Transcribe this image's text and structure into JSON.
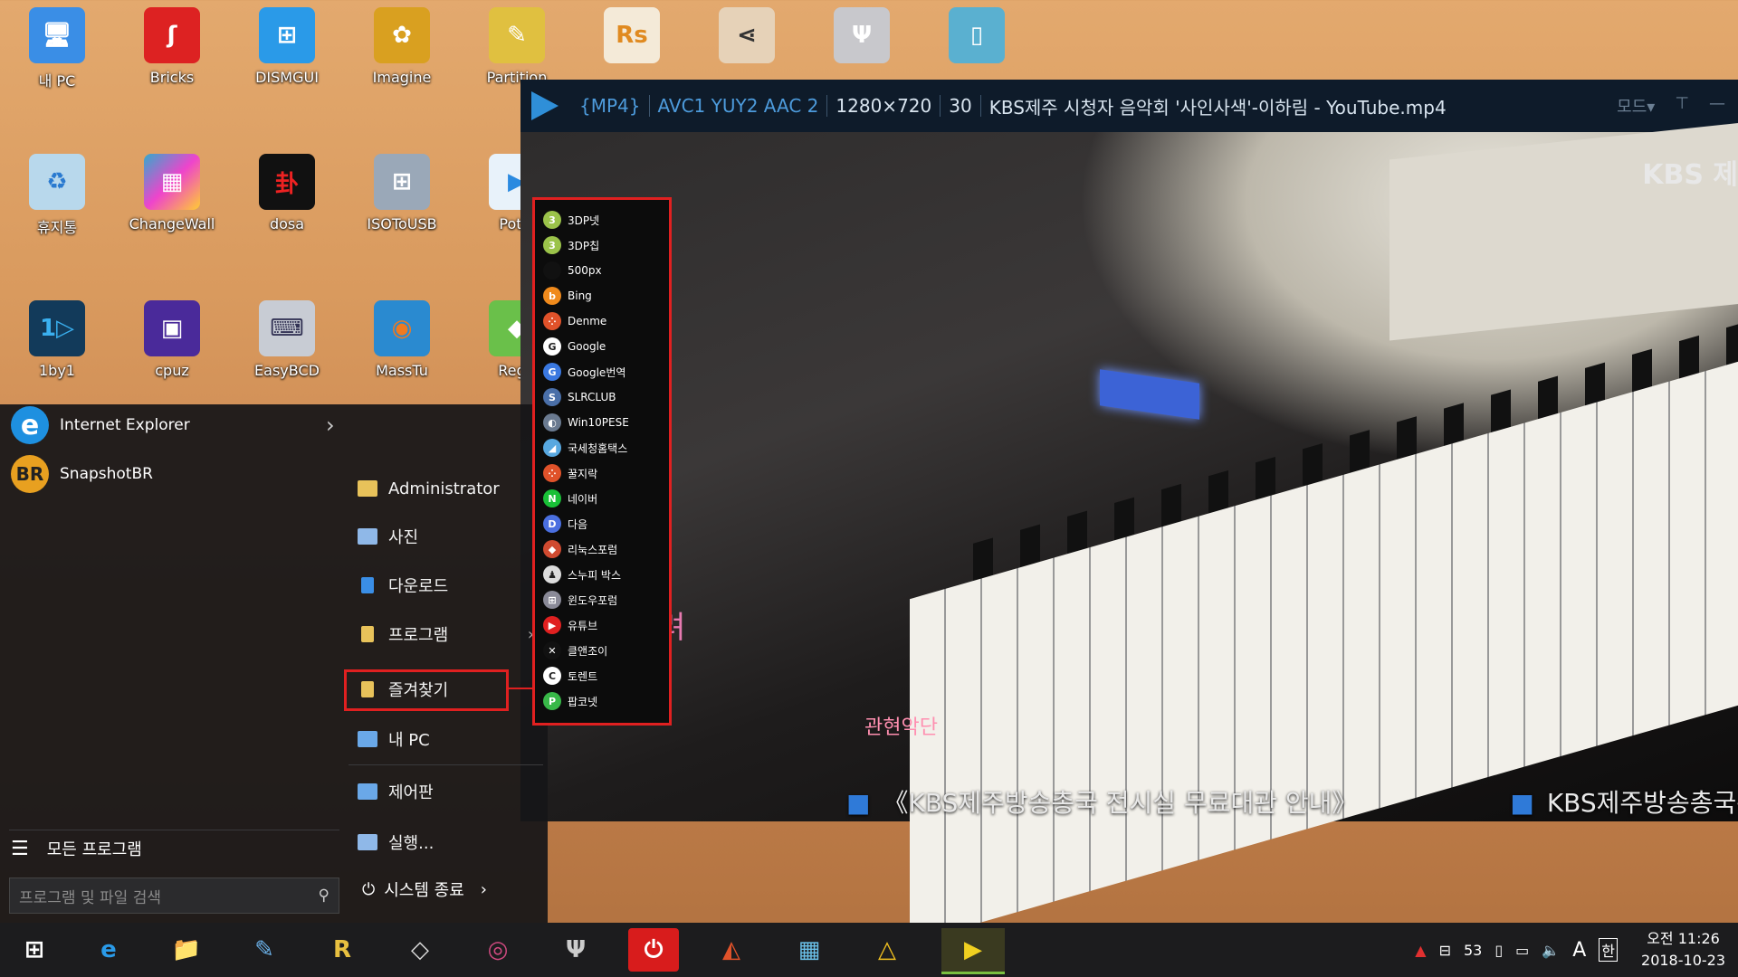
{
  "desktop": {
    "icons": [
      {
        "label": "내 PC",
        "glyph": "🖥"
      },
      {
        "label": "Bricks",
        "glyph": "ʃ"
      },
      {
        "label": "DISMGUI",
        "glyph": "⊞"
      },
      {
        "label": "Imagine",
        "glyph": "✿"
      },
      {
        "label": "Partition",
        "glyph": "✎"
      },
      {
        "label": "",
        "glyph": "Rs"
      },
      {
        "label": "",
        "glyph": "⋖"
      },
      {
        "label": "",
        "glyph": "Ψ"
      },
      {
        "label": "",
        "glyph": "▯"
      },
      {
        "label": "휴지통",
        "glyph": "♻"
      },
      {
        "label": "ChangeWall",
        "glyph": "▦"
      },
      {
        "label": "dosa",
        "glyph": "卦"
      },
      {
        "label": "ISOToUSB",
        "glyph": "⊞"
      },
      {
        "label": "PotPl",
        "glyph": "▶"
      },
      {
        "label": "1by1",
        "glyph": "1▷"
      },
      {
        "label": "cpuz",
        "glyph": "▣"
      },
      {
        "label": "EasyBCD",
        "glyph": "⌨"
      },
      {
        "label": "MassTu",
        "glyph": "◉"
      },
      {
        "label": "RegC",
        "glyph": "◆"
      }
    ]
  },
  "player": {
    "format": "{MP4}",
    "codecs": "AVC1  YUY2  AAC 2",
    "resolution": "1280×720",
    "fps": "30",
    "title": "KBS제주 시청자 음악회 '사인사색'-이하림 - YouTube.mp4",
    "mode_label": "모드▾",
    "kbs_logo": "KBS 제",
    "subtitle": "그려",
    "ticker1": "《KBS제주방송총국 전시실 무료대관 안내》",
    "ticker2": "KBS제주방송총국은 도",
    "caption": "관현악단"
  },
  "start_menu": {
    "pinned": [
      {
        "label": "Internet Explorer",
        "glyph": "e",
        "color": "#1e90e0"
      },
      {
        "label": "SnapshotBR",
        "glyph": "BR",
        "color": "#e8a020"
      }
    ],
    "right_items": [
      {
        "label": "Administrator",
        "color": "#e8c25a"
      },
      {
        "label": "사진",
        "color": "#8fb8e8"
      },
      {
        "label": "다운로드",
        "color": "#3a8ee6"
      },
      {
        "label": "프로그램",
        "color": "#e8c25a"
      },
      {
        "label": "즐겨찾기",
        "color": "#e8c25a"
      },
      {
        "label": "내 PC",
        "color": "#6aa8e8"
      },
      {
        "label": "제어판",
        "color": "#6aa8e8"
      },
      {
        "label": "실행...",
        "color": "#8fb8e8"
      }
    ],
    "all_programs": "모든 프로그램",
    "search_placeholder": "프로그램 및 파일 검색",
    "shutdown": "시스템 종료"
  },
  "favorites": [
    {
      "label": "3DP넷",
      "color": "#9bc34a",
      "glyph": "3"
    },
    {
      "label": "3DP칩",
      "color": "#9bc34a",
      "glyph": "3"
    },
    {
      "label": "500px",
      "color": "#111111",
      "glyph": ""
    },
    {
      "label": "Bing",
      "color": "#f08a1c",
      "glyph": "b"
    },
    {
      "label": "Denme",
      "color": "#e0522a",
      "glyph": "⁘"
    },
    {
      "label": "Google",
      "color": "#ffffff",
      "glyph": "G"
    },
    {
      "label": "Google번역",
      "color": "#3a78e0",
      "glyph": "G"
    },
    {
      "label": "SLRCLUB",
      "color": "#4a6fa8",
      "glyph": "S"
    },
    {
      "label": "Win10PESE",
      "color": "#6a7a90",
      "glyph": "◐"
    },
    {
      "label": "국세청홈택스",
      "color": "#58a8e0",
      "glyph": "◢"
    },
    {
      "label": "꿀지락",
      "color": "#e0522a",
      "glyph": "⁘"
    },
    {
      "label": "네이버",
      "color": "#19c037",
      "glyph": "N"
    },
    {
      "label": "다음",
      "color": "#4a6fe0",
      "glyph": "D"
    },
    {
      "label": "리눅스포럼",
      "color": "#d04a30",
      "glyph": "◆"
    },
    {
      "label": "스누피 박스",
      "color": "#dddddd",
      "glyph": "♟"
    },
    {
      "label": "윈도우포럼",
      "color": "#8a8a98",
      "glyph": "⊞"
    },
    {
      "label": "유튜브",
      "color": "#e02020",
      "glyph": "▶"
    },
    {
      "label": "클앤조이",
      "color": "#111111",
      "glyph": "✕"
    },
    {
      "label": "토렌트",
      "color": "#ffffff",
      "glyph": "C"
    },
    {
      "label": "팝코넷",
      "color": "#38b848",
      "glyph": "P"
    }
  ],
  "taskbar": {
    "apps": [
      "⊞",
      "e",
      "📁",
      "✎",
      "R",
      "◇",
      "◎",
      "Ψ",
      "⏻",
      "◭",
      "▦",
      "△",
      "▶"
    ],
    "tray_number": "53",
    "ime_a": "A",
    "ime_han": "한",
    "time": "오전 11:26",
    "date": "2018-10-23"
  }
}
